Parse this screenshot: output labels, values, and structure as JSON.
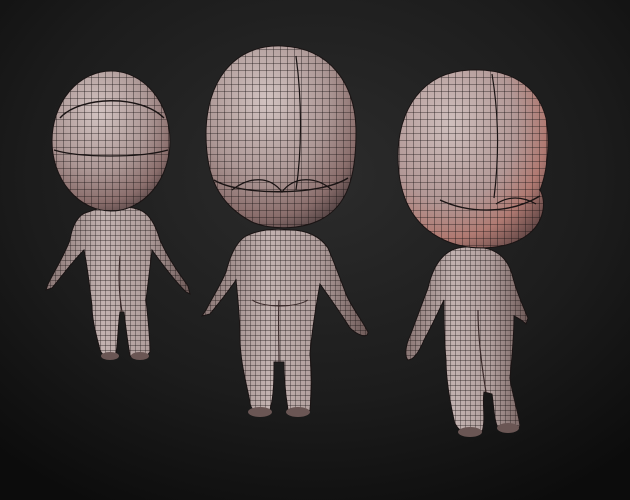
{
  "scene": {
    "background_colors": {
      "center": "#2c2c2c",
      "edge": "#0c0c0c"
    },
    "skin_colors": {
      "light": "#c8b8b6",
      "mid": "#a89492",
      "shadow": "#5a4848",
      "warm": "#c89088"
    },
    "wire_color": "#1a1414",
    "figures": [
      {
        "view": "back"
      },
      {
        "view": "front"
      },
      {
        "view": "three-quarter"
      }
    ]
  }
}
